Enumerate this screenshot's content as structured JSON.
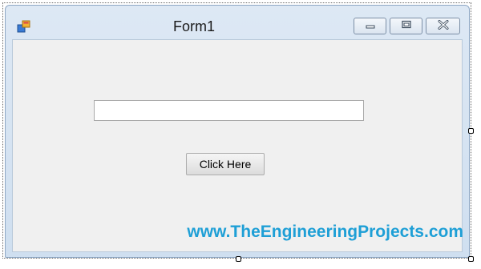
{
  "window": {
    "title": "Form1",
    "icon": "windows-forms-app-icon",
    "controls": {
      "minimize_icon": "minimize-icon",
      "maximize_icon": "maximize-icon",
      "close_icon": "close-icon"
    }
  },
  "form": {
    "textbox": {
      "value": "",
      "placeholder": ""
    },
    "button": {
      "label": "Click Here"
    }
  },
  "watermark": {
    "text": "www.TheEngineeringProjects.com",
    "color": "#1e9fd6"
  }
}
